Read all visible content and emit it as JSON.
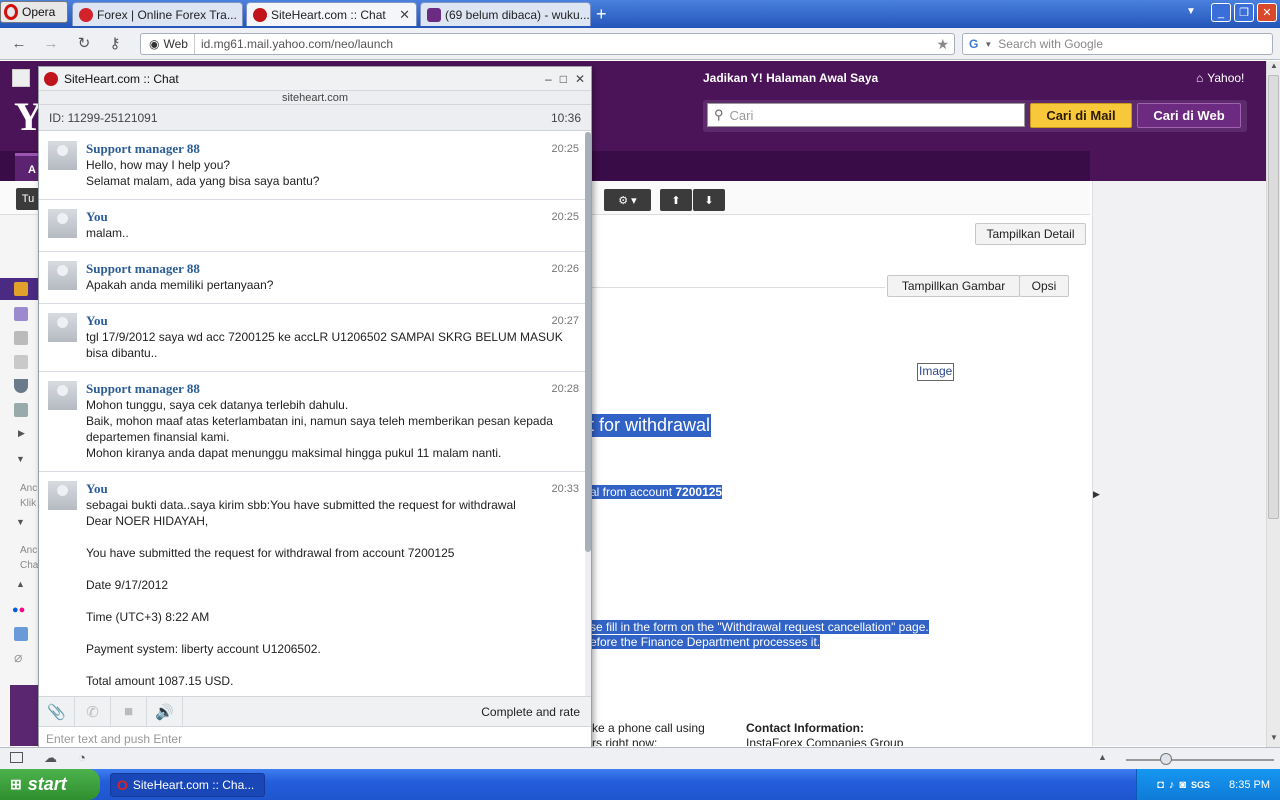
{
  "browser": {
    "opera_label": "Opera",
    "tabs": [
      {
        "label": "Forex | Online Forex Tra...",
        "active": false
      },
      {
        "label": "SiteHeart.com :: Chat",
        "active": true
      },
      {
        "label": "(69 belum dibaca) - wuku...",
        "active": false
      }
    ],
    "address": {
      "web_label": "Web",
      "url": "id.mg61.mail.yahoo.com/neo/launch"
    },
    "search_placeholder": "Search with Google"
  },
  "yahoo": {
    "homepage_link": "Jadikan Y! Halaman Awal Saya",
    "home_label": "Yahoo!",
    "search_placeholder": "Cari",
    "search_mail_btn": "Cari di Mail",
    "search_web_btn": "Cari di Web",
    "show_detail_btn": "Tampilkan Detail",
    "show_images_btn": "Tampillkan Gambar",
    "options_btn": "Opsi",
    "image_label": "Image",
    "heading_fragment": "t for withdrawal",
    "line_fragment_1": "al from account ",
    "line_fragment_1_bold": "7200125",
    "line_fragment_2": "se fill in the form on the \"Withdrawal request cancellation\" page.",
    "line_fragment_3": "efore the Finance Department processes it.",
    "footer_left_1": "ke a phone call using",
    "footer_left_2": "rs right now:",
    "footer_right_title": "Contact Information:",
    "footer_right_2": "InstaForex Companies Group",
    "side_fragments": [
      "Anc",
      "Klik",
      "Anc",
      "Cha"
    ]
  },
  "chat": {
    "window_title": "SiteHeart.com :: Chat",
    "site": "siteheart.com",
    "chat_id": "ID: 11299-25121091",
    "clock": "10:36",
    "messages": [
      {
        "name": "Support manager 88",
        "time": "20:25",
        "text": "Hello, how may I help you?\nSelamat malam, ada yang bisa saya bantu?"
      },
      {
        "name": "You",
        "time": "20:25",
        "text": "malam.."
      },
      {
        "name": "Support manager 88",
        "time": "20:26",
        "text": "Apakah anda memiliki pertanyaan?"
      },
      {
        "name": "You",
        "time": "20:27",
        "text": "tgl 17/9/2012 saya wd acc 7200125 ke accLR U1206502 SAMPAI SKRG BELUM MASUK\nbisa dibantu.."
      },
      {
        "name": "Support manager 88",
        "time": "20:28",
        "text": "Mohon tunggu, saya cek datanya terlebih dahulu.\nBaik, mohon maaf atas keterlambatan ini, namun saya teleh memberikan pesan kepada\ndepartemen finansial kami.\nMohon kiranya anda dapat menunggu maksimal hingga pukul 11 malam nanti."
      },
      {
        "name": "You",
        "time": "20:33",
        "text": "sebagai bukti data..saya kirim sbb:You have submitted the request for withdrawal\nDear NOER HIDAYAH,\n\nYou have submitted the request for withdrawal from account 7200125\n\nDate 9/17/2012\n\nTime (UTC+3) 8:22 AM\n\nPayment system: liberty account U1206502.\n\nTotal amount 1087.15 USD."
      }
    ],
    "complete_and_rate": "Complete and rate",
    "input_placeholder": "Enter text and push Enter"
  },
  "taskbar": {
    "start_label": "start",
    "task_label": "SiteHeart.com :: Cha...",
    "clock": "8:35 PM",
    "tray_badge": "SGS"
  }
}
